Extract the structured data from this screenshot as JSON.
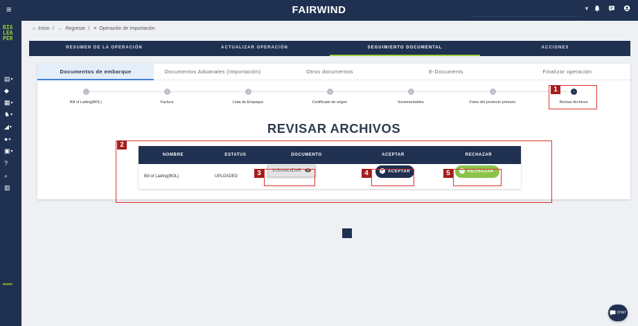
{
  "header": {
    "title": "FAIRWIND"
  },
  "sidebar": {
    "logo_lines": [
      "BIG",
      "LEA",
      "PER"
    ]
  },
  "breadcrumb": {
    "home": "Inicio",
    "back": "Regresar",
    "current": "Operación de Importación"
  },
  "main_tabs": [
    {
      "label": "RESUMEN DE LA OPERACIÓN"
    },
    {
      "label": "ACTUALIZAR OPERACIÓN"
    },
    {
      "label": "SEGUIMIENTO DOCUMENTAL",
      "active": true
    },
    {
      "label": "ACCIONES"
    }
  ],
  "sub_tabs": [
    {
      "label": "Documentos de embarque",
      "active": true
    },
    {
      "label": "Documentos Aduanales (Importación)"
    },
    {
      "label": "Otros documentos"
    },
    {
      "label": "E-Documents"
    },
    {
      "label": "Finalizar operación"
    }
  ],
  "steps": [
    {
      "label": "Bill of Lading(BOL)"
    },
    {
      "label": "Factura"
    },
    {
      "label": "Lista de Empaque"
    },
    {
      "label": "Certificado de origen"
    },
    {
      "label": "Incrementables"
    },
    {
      "label": "Fotos del producto primario"
    },
    {
      "label": "Revisar Archivos",
      "active": true
    }
  ],
  "section_title": "REVISAR ARCHIVOS",
  "table": {
    "headers": {
      "nombre": "NOMBRE",
      "estatus": "ESTATUS",
      "documento": "DOCUMENTO",
      "aceptar": "ACEPTAR",
      "rechazar": "RECHAZAR"
    },
    "row": {
      "nombre": "Bill of Lading(BOL)",
      "estatus": "UPLOADED"
    }
  },
  "buttons": {
    "visualizar": "VISUALIZAR",
    "aceptar": "ACEPTAR",
    "rechazar": "RECHAZAR"
  },
  "callouts": {
    "c1": "1",
    "c2": "2",
    "c3": "3",
    "c4": "4",
    "c5": "5"
  },
  "chat": {
    "label": "CHAT"
  },
  "colors": {
    "navy": "#1f3050",
    "green": "#8bc34a",
    "callout": "#d9302a"
  }
}
